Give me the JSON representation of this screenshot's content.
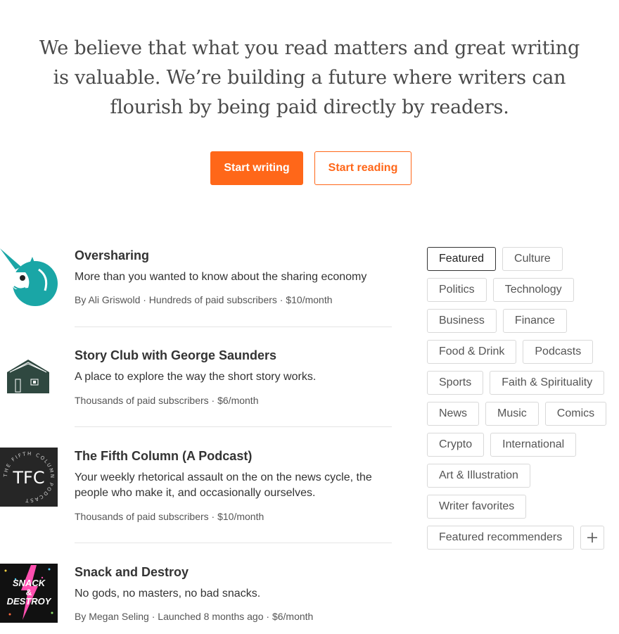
{
  "hero": {
    "line1": "We believe that what you read matters and great writing",
    "line2": "is valuable. We’re building a future where writers can",
    "line3": "flourish by being paid directly by readers."
  },
  "actions": {
    "start_writing": "Start writing",
    "start_reading": "Start reading"
  },
  "publications": [
    {
      "name": "Oversharing",
      "description": "More than you wanted to know about the sharing economy",
      "meta": "By Ali Griswold · Hundreds of paid subscribers · $10/month",
      "logo_icon": "unicorn-icon"
    },
    {
      "name": "Story Club with George Saunders",
      "description": "A place to explore the way the short story works.",
      "meta": "Thousands of paid subscribers · $6/month",
      "logo_icon": "barn-icon"
    },
    {
      "name": "The Fifth Column (A Podcast)",
      "description": "Your weekly rhetorical assault on the on the news cycle, the people who make it, and occasionally ourselves.",
      "meta": "Thousands of paid subscribers · $10/month",
      "logo_icon": "tfc-badge",
      "logo_text": "TFC",
      "logo_ring_text": "THE FIFTH COLUMN PODCAST"
    },
    {
      "name": "Snack and Destroy",
      "description": "No gods, no masters, no bad snacks.",
      "meta": "By Megan Seling · Launched 8 months ago · $6/month",
      "logo_icon": "snack-destroy-badge",
      "logo_lines": [
        "SNACK",
        "&",
        "DESTROY"
      ]
    }
  ],
  "categories": {
    "rows": [
      [
        "Featured",
        "Culture"
      ],
      [
        "Politics",
        "Technology"
      ],
      [
        "Business",
        "Finance"
      ],
      [
        "Food & Drink",
        "Podcasts"
      ],
      [
        "Sports",
        "Faith & Spirituality"
      ],
      [
        "News",
        "Music",
        "Comics"
      ],
      [
        "Crypto",
        "International"
      ],
      [
        "Art & Illustration"
      ],
      [
        "Writer favorites"
      ],
      [
        "Featured recommenders"
      ]
    ],
    "active": "Featured",
    "more_icon": "plus-icon"
  },
  "colors": {
    "accent": "#ff6719",
    "unicorn": "#1aa6a6",
    "barn": "#2f4840",
    "tfc_bg": "#262626",
    "snack_bg": "#111111",
    "snack_bolt": "#ff4fb0"
  }
}
